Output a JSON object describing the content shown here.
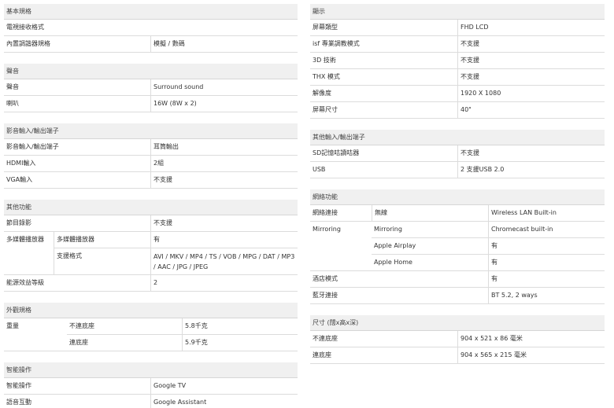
{
  "left": {
    "basic": {
      "title": "基本規格",
      "rows": [
        {
          "label": "電視接收格式",
          "value": ""
        },
        {
          "label": "內置調諧器規格",
          "value": "模擬 / 數碼"
        }
      ]
    },
    "audio": {
      "title": "聲音",
      "rows": [
        {
          "label": "聲音",
          "value": "Surround sound"
        },
        {
          "label": "喇叭",
          "value": "16W (8W x 2)"
        }
      ]
    },
    "av_io": {
      "title": "影音輸入/輸出端子",
      "rows": [
        {
          "label": "影音輸入/輸出端子",
          "value": "耳筒輸出"
        },
        {
          "label": "HDMI輸入",
          "value": "2組"
        },
        {
          "label": "VGA輸入",
          "value": "不支援"
        }
      ]
    },
    "other": {
      "title": "其他功能",
      "program_recording": {
        "label": "節目錄影",
        "value": "不支援"
      },
      "media_player": {
        "label": "多媒體播放器",
        "sub1_label": "多媒體播放器",
        "sub1_value": "有",
        "sub2_label": "支援格式",
        "sub2_value": "AVI / MKV / MP4 / TS / VOB / MPG / DAT / MP3 / AAC / JPG / JPEG"
      },
      "energy": {
        "label": "能源效益等級",
        "value": "2"
      }
    },
    "exterior": {
      "title": "外觀規格",
      "weight_label": "重量",
      "rows": [
        {
          "label": "不連底座",
          "value": "5.8千克"
        },
        {
          "label": "連底座",
          "value": "5.9千克"
        }
      ]
    },
    "smart": {
      "title": "智能操作",
      "rows": [
        {
          "label": "智能操作",
          "value": "Google TV"
        },
        {
          "label": "語音互動",
          "value": "Google Assistant"
        }
      ]
    }
  },
  "right": {
    "display": {
      "title": "顯示",
      "rows": [
        {
          "label": "屏幕類型",
          "value": "FHD LCD"
        },
        {
          "label": "isf 專業調教模式",
          "value": "不支援"
        },
        {
          "label": "3D 技術",
          "value": "不支援"
        },
        {
          "label": "THX 模式",
          "value": "不支援"
        },
        {
          "label": "解像度",
          "value": "1920 X 1080"
        },
        {
          "label": "屏幕尺寸",
          "value": "40\""
        }
      ]
    },
    "other_io": {
      "title": "其他輸入/輸出端子",
      "rows": [
        {
          "label": "SD記憶咭讀咭器",
          "value": "不支援"
        },
        {
          "label": "USB",
          "value": "2 支援USB 2.0"
        }
      ]
    },
    "network": {
      "title": "網絡功能",
      "network_row": {
        "label": "網絡連接",
        "sub": "無線",
        "value": "Wireless LAN Built-in"
      },
      "mirroring": {
        "label": "Mirroring",
        "rows": [
          {
            "sub": "Mirroring",
            "value": "Chromecast built-in"
          },
          {
            "sub": "Apple Airplay",
            "value": "有"
          },
          {
            "sub": "Apple Home",
            "value": "有"
          }
        ]
      },
      "hotel": {
        "label": "酒店模式",
        "value": "有"
      },
      "bluetooth": {
        "label": "藍牙連接",
        "value": "BT 5.2, 2 ways"
      }
    },
    "size": {
      "title": "尺寸 (闊x高x深)",
      "rows": [
        {
          "label": "不連底座",
          "value": "904 x 521 x 86 毫米"
        },
        {
          "label": "連底座",
          "value": "904 x 565 x 215 毫米"
        }
      ]
    }
  }
}
